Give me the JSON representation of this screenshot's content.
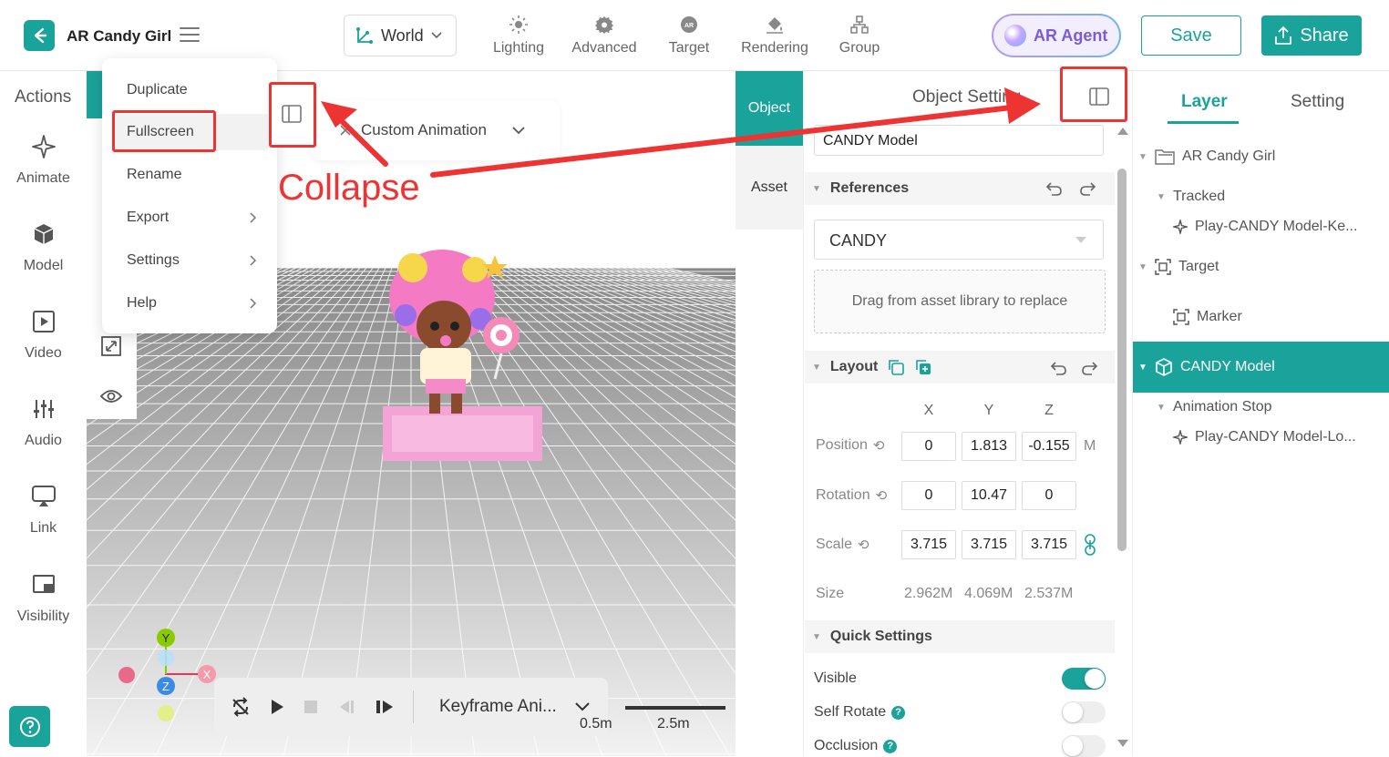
{
  "header": {
    "app_title": "AR Candy Girl",
    "world_label": "World",
    "tools": [
      {
        "label": "Lighting",
        "icon": "sun-icon"
      },
      {
        "label": "Advanced",
        "icon": "gear-icon"
      },
      {
        "label": "Target",
        "icon": "ar-target-icon"
      },
      {
        "label": "Rendering",
        "icon": "paint-bucket-icon"
      },
      {
        "label": "Group",
        "icon": "group-icon"
      }
    ],
    "ar_agent_label": "AR Agent",
    "save_label": "Save",
    "share_label": "Share"
  },
  "sidebar": {
    "title": "Actions",
    "items": [
      {
        "label": "Animate",
        "icon": "sparkle-icon"
      },
      {
        "label": "Model",
        "icon": "cube-icon"
      },
      {
        "label": "Video",
        "icon": "video-play-icon"
      },
      {
        "label": "Audio",
        "icon": "audio-sliders-icon"
      },
      {
        "label": "Link",
        "icon": "cast-link-icon"
      },
      {
        "label": "Visibility",
        "icon": "visibility-icon"
      }
    ]
  },
  "context_menu": {
    "items": [
      {
        "label": "Duplicate",
        "submenu": false
      },
      {
        "label": "Fullscreen",
        "submenu": false
      },
      {
        "label": "Rename",
        "submenu": false
      },
      {
        "label": "Export",
        "submenu": true
      },
      {
        "label": "Settings",
        "submenu": true
      },
      {
        "label": "Help",
        "submenu": true
      }
    ]
  },
  "annotation": {
    "collapse_label": "Collapse"
  },
  "viewport": {
    "custom_animation": "Custom Animation",
    "player": {
      "animation_name": "Keyframe Ani..."
    },
    "scale_left": "0.5m",
    "scale_right": "2.5m",
    "gizmo": {
      "y": "Y",
      "z": "Z",
      "x": "X"
    }
  },
  "object_panel": {
    "tab_object": "Object",
    "tab_asset": "Asset",
    "title": "Object Setting",
    "name_value": "CANDY Model",
    "references": {
      "title": "References",
      "selected": "CANDY",
      "drop_text": "Drag from asset library to replace"
    },
    "layout": {
      "title": "Layout",
      "axes": [
        "X",
        "Y",
        "Z"
      ],
      "position_label": "Position",
      "position": [
        "0",
        "1.813",
        "-0.155"
      ],
      "position_unit": "M",
      "rotation_label": "Rotation",
      "rotation": [
        "0",
        "10.47",
        "0"
      ],
      "scale_label": "Scale",
      "scale": [
        "3.715",
        "3.715",
        "3.715"
      ],
      "size_label": "Size",
      "size": [
        "2.962M",
        "4.069M",
        "2.537M"
      ]
    },
    "quick_settings": {
      "title": "Quick Settings",
      "items": [
        {
          "label": "Visible",
          "on": true,
          "help": false
        },
        {
          "label": "Self Rotate",
          "on": false,
          "help": true
        },
        {
          "label": "Occlusion",
          "on": false,
          "help": true
        }
      ]
    }
  },
  "layer_panel": {
    "tab_layer": "Layer",
    "tab_setting": "Setting",
    "tree": [
      {
        "label": "AR Candy Girl",
        "icon": "folder-icon"
      },
      {
        "label": "Tracked",
        "icon": ""
      },
      {
        "label": "Play-CANDY Model-Ke...",
        "icon": "sparkle-icon"
      },
      {
        "label": "Target",
        "icon": "scan-target-icon"
      },
      {
        "label": "Marker",
        "icon": "scan-target-icon"
      },
      {
        "label": "CANDY Model",
        "icon": "cube-icon"
      },
      {
        "label": "Animation Stop",
        "icon": ""
      },
      {
        "label": "Play-CANDY Model-Lo...",
        "icon": "sparkle-icon"
      }
    ]
  },
  "colors": {
    "accent": "#1aa39a",
    "annotation_red": "#e33333",
    "ar_agent_purple": "#7b5cd6"
  }
}
